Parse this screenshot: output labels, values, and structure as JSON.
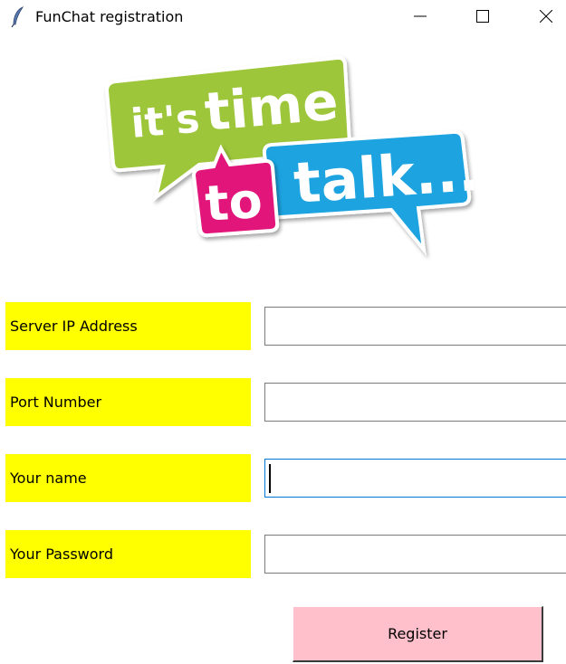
{
  "window": {
    "title": "FunChat registration",
    "app_icon": "feather-icon",
    "controls": {
      "minimize_icon": "minimize-icon",
      "maximize_icon": "maximize-icon",
      "close_icon": "close-icon"
    }
  },
  "logo": {
    "line1_prefix": "it's",
    "line1_word": "time",
    "line2_word": "to",
    "line3_word": "talk...",
    "colors": {
      "green_bubble": "#9dc63b",
      "pink_bubble": "#e2147a",
      "blue_bubble": "#1aa3e0"
    }
  },
  "form": {
    "fields": [
      {
        "label": "Server IP Address",
        "value": "",
        "focused": false
      },
      {
        "label": "Port Number",
        "value": "",
        "focused": false
      },
      {
        "label": "Your name",
        "value": "",
        "focused": true
      },
      {
        "label": "Your Password",
        "value": "",
        "focused": false
      }
    ],
    "label_bg_color": "#ffff00",
    "register_label": "Register",
    "register_bg_color": "#ffc0cb"
  }
}
